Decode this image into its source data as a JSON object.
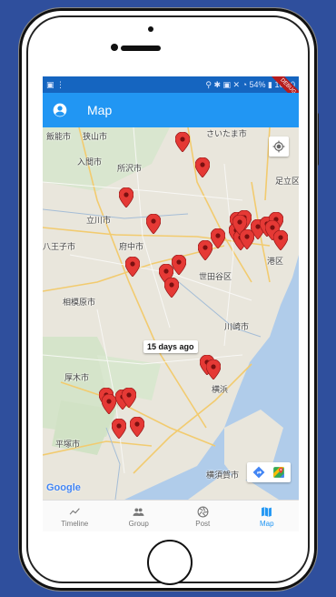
{
  "status_bar": {
    "right_text": "⚲ ✱ ▣ ✕ ◔ 54% ▮ 16:00",
    "debug_label": "DEBUG"
  },
  "app_bar": {
    "title": "Map",
    "icon": "account-circle-icon"
  },
  "map": {
    "places": [
      "飯能市",
      "狭山市",
      "さいたま市",
      "入間市",
      "所沢市",
      "足立区",
      "立川市",
      "府中市",
      "八王子市",
      "世田谷区",
      "港区",
      "相模原市",
      "川崎市",
      "厚木市",
      "横浜",
      "平塚市",
      "横須賀市"
    ],
    "tooltip": "15 days ago",
    "attribution": "Google",
    "controls": [
      "my-location-icon",
      "directions-icon",
      "google-maps-icon"
    ],
    "pin_color": "#e53935"
  },
  "bottom_nav": {
    "items": [
      {
        "label": "Timeline",
        "icon": "timeline-icon"
      },
      {
        "label": "Group",
        "icon": "group-icon"
      },
      {
        "label": "Post",
        "icon": "camera-aperture-icon"
      },
      {
        "label": "Map",
        "icon": "map-icon"
      }
    ],
    "active": "Map",
    "active_color": "#2196f3"
  }
}
